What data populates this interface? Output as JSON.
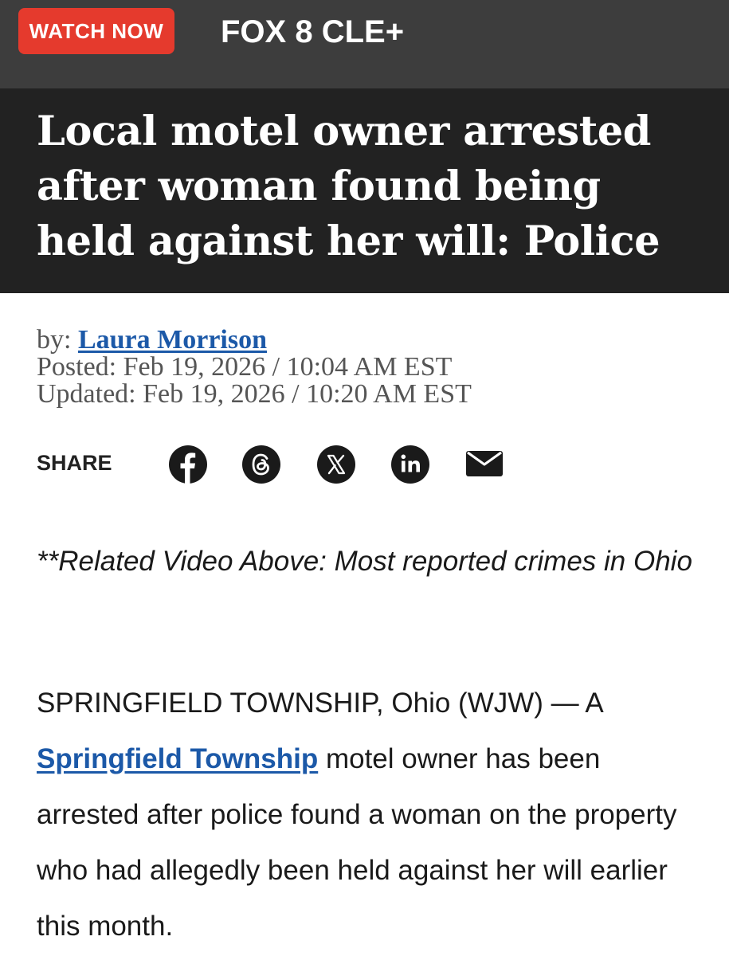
{
  "header": {
    "watch_button": "WATCH NOW",
    "brand": "FOX 8 CLE+"
  },
  "article": {
    "headline": "Local motel owner arrested after woman found being held against her will: Police",
    "byline_prefix": "by: ",
    "author": "Laura Morrison",
    "posted": "Posted: Feb 19, 2026 / 10:04 AM EST",
    "updated": "Updated: Feb 19, 2026 / 10:20 AM EST",
    "related_video": "**Related Video Above: Most reported crimes in Ohio",
    "para_lead": "SPRINGFIELD TOWNSHIP, Ohio (WJW) — A ",
    "para_link": "Springfield Township",
    "para_rest": " motel owner has been arrested after police found a woman on the property who had allegedly been held against her will earlier this month."
  },
  "share": {
    "label": "SHARE",
    "icons": [
      "facebook-icon",
      "threads-icon",
      "x-icon",
      "linkedin-icon",
      "email-icon"
    ]
  },
  "colors": {
    "watch_button": "#e53a2d",
    "topbar": "#3d3d3d",
    "headline_bg": "#222222",
    "link": "#1c59a8"
  }
}
